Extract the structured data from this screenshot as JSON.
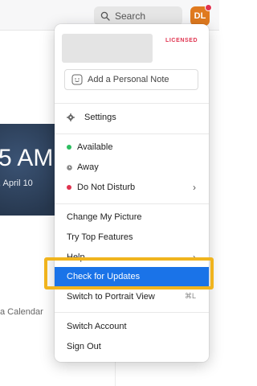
{
  "topbar": {
    "search_label": "Search",
    "avatar_initials": "DL"
  },
  "background": {
    "clock_time": "5 AM",
    "clock_date": ", April 10",
    "calendar_text": "a Calendar"
  },
  "menu": {
    "license_badge": "LICENSED",
    "note_placeholder": "Add a Personal Note",
    "settings_label": "Settings",
    "status_items": [
      {
        "label": "Available",
        "color": "#2dbe60"
      },
      {
        "label": "Away",
        "color": "#8a8a8a"
      },
      {
        "label": "Do Not Disturb",
        "color": "#e0334f"
      }
    ],
    "change_picture_label": "Change My Picture",
    "top_features_label": "Try Top Features",
    "help_label": "Help",
    "check_updates_label": "Check for Updates",
    "portrait_label": "Switch to Portrait View",
    "portrait_shortcut": "⌘L",
    "switch_account_label": "Switch Account",
    "sign_out_label": "Sign Out"
  },
  "colors": {
    "highlight": "#1a73e8",
    "annotation_frame": "#f0b41e",
    "avatar": "#e07a1f"
  }
}
